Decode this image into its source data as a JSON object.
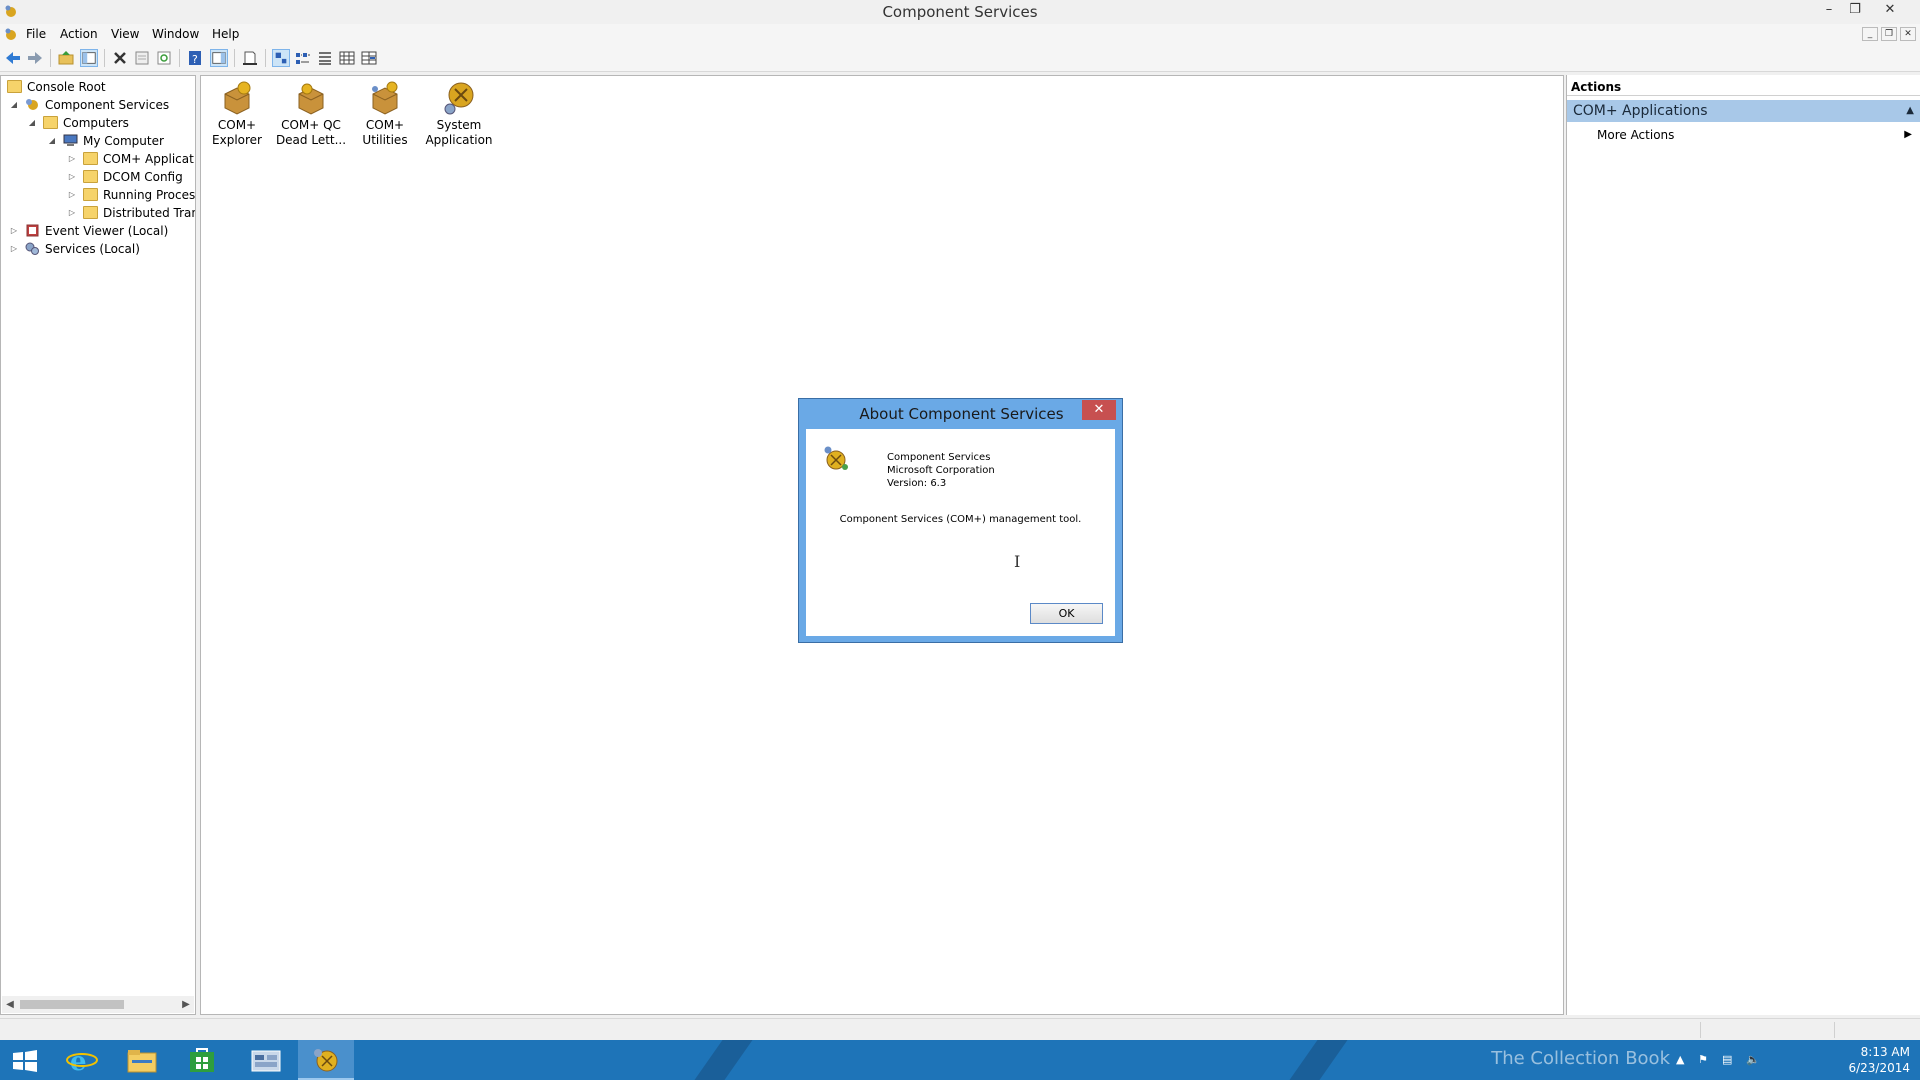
{
  "window": {
    "title": "Component Services",
    "minimize": "–",
    "restore": "❐",
    "close": "✕"
  },
  "menubar": {
    "items": [
      "File",
      "Action",
      "View",
      "Window",
      "Help"
    ],
    "mdi": [
      "_",
      "❐",
      "✕"
    ]
  },
  "toolbar": {
    "icons": [
      "back-icon",
      "forward-icon",
      "up-folder-icon",
      "show-hide-tree-icon",
      "delete-icon",
      "properties-icon",
      "refresh-icon",
      "help-icon",
      "show-hide-action-pane-icon",
      "export-list-icon",
      "large-icons-view-icon",
      "small-icons-view-icon",
      "list-view-icon",
      "detail-view-icon",
      "custom-view-icon"
    ]
  },
  "tree": {
    "items": [
      {
        "label": "Console Root",
        "level": 0,
        "expander": "",
        "icon": "folder-icon"
      },
      {
        "label": "Component Services",
        "level": 1,
        "expander": "◢",
        "icon": "component-services-icon"
      },
      {
        "label": "Computers",
        "level": 2,
        "expander": "◢",
        "icon": "folder-icon"
      },
      {
        "label": "My Computer",
        "level": 3,
        "expander": "◢",
        "icon": "my-computer-icon"
      },
      {
        "label": "COM+ Applicatio",
        "level": 4,
        "expander": "▷",
        "icon": "folder-icon"
      },
      {
        "label": "DCOM Config",
        "level": 4,
        "expander": "▷",
        "icon": "folder-icon"
      },
      {
        "label": "Running Processe",
        "level": 4,
        "expander": "▷",
        "icon": "folder-icon"
      },
      {
        "label": "Distributed Trans",
        "level": 4,
        "expander": "▷",
        "icon": "folder-icon"
      },
      {
        "label": "Event Viewer (Local)",
        "level": 1,
        "expander": "▷",
        "icon": "event-viewer-icon"
      },
      {
        "label": "Services (Local)",
        "level": 1,
        "expander": "▷",
        "icon": "services-icon"
      }
    ],
    "scroll_left": "◀",
    "scroll_right": "▶"
  },
  "center": {
    "items": [
      {
        "label": "COM+ Explorer",
        "icon": "com-explorer-icon"
      },
      {
        "label": "COM+ QC Dead Lett...",
        "icon": "com-qc-dead-letter-icon"
      },
      {
        "label": "COM+ Utilities",
        "icon": "com-utilities-icon"
      },
      {
        "label": "System Application",
        "icon": "system-application-icon"
      }
    ]
  },
  "actions": {
    "header": "Actions",
    "section": "COM+ Applications",
    "section_caret": "▲",
    "more": "More Actions",
    "more_caret": "▶"
  },
  "dialog": {
    "title": "About Component Services",
    "close": "✕",
    "product": "Component Services",
    "company": "Microsoft Corporation",
    "version": "Version: 6.3",
    "description": "Component Services (COM+) management tool.",
    "ok": "OK"
  },
  "taskbar": {
    "apps": [
      "internet-explorer-icon",
      "file-explorer-icon",
      "store-icon",
      "server-manager-icon",
      "component-services-icon"
    ],
    "watermark": "The Collection Book",
    "time": "8:13 AM",
    "date": "6/23/2014"
  },
  "colors": {
    "taskbar": "#1e74b8",
    "dialog_frame": "#6aa9e6",
    "actions_section": "#a8c8e8"
  }
}
